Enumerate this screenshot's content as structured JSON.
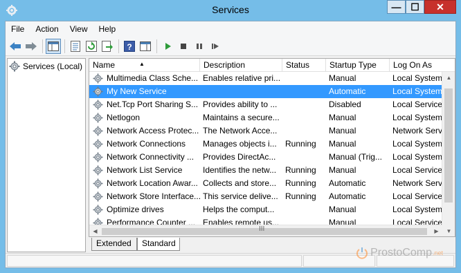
{
  "window": {
    "title": "Services"
  },
  "colors": {
    "selection": "#3399ff",
    "titlebar": "#75bde8",
    "close_button": "#c7312c"
  },
  "window_controls": {
    "minimize": "—",
    "maximize": "☐",
    "close": "✕"
  },
  "menu": [
    "File",
    "Action",
    "View",
    "Help"
  ],
  "toolbar": {
    "icons": [
      "back-arrow-icon",
      "forward-arrow-icon",
      "show-hide-console-tree-icon",
      "properties-icon",
      "refresh-icon",
      "export-list-icon",
      "help-icon",
      "action-pane-icon",
      "start-service-icon",
      "stop-service-icon",
      "pause-service-icon",
      "restart-service-icon"
    ]
  },
  "tree": {
    "root_label": "Services (Local)"
  },
  "table": {
    "columns": [
      "Name",
      "Description",
      "Status",
      "Startup Type",
      "Log On As"
    ],
    "rows": [
      {
        "name": "Multimedia Class Sche...",
        "description": "Enables relative pri...",
        "status": "",
        "startup": "Manual",
        "logon": "Local System",
        "selected": false
      },
      {
        "name": "My New Service",
        "description": "",
        "status": "",
        "startup": "Automatic",
        "logon": "Local System",
        "selected": true
      },
      {
        "name": "Net.Tcp Port Sharing S...",
        "description": "Provides ability to ...",
        "status": "",
        "startup": "Disabled",
        "logon": "Local Service",
        "selected": false
      },
      {
        "name": "Netlogon",
        "description": "Maintains a secure...",
        "status": "",
        "startup": "Manual",
        "logon": "Local System",
        "selected": false
      },
      {
        "name": "Network Access Protec...",
        "description": "The Network Acce...",
        "status": "",
        "startup": "Manual",
        "logon": "Network Servi",
        "selected": false
      },
      {
        "name": "Network Connections",
        "description": "Manages objects i...",
        "status": "Running",
        "startup": "Manual",
        "logon": "Local System",
        "selected": false
      },
      {
        "name": "Network Connectivity ...",
        "description": "Provides DirectAc...",
        "status": "",
        "startup": "Manual (Trig...",
        "logon": "Local System",
        "selected": false
      },
      {
        "name": "Network List Service",
        "description": "Identifies the netw...",
        "status": "Running",
        "startup": "Manual",
        "logon": "Local Service",
        "selected": false
      },
      {
        "name": "Network Location Awar...",
        "description": "Collects and store...",
        "status": "Running",
        "startup": "Automatic",
        "logon": "Network Servi",
        "selected": false
      },
      {
        "name": "Network Store Interface...",
        "description": "This service delive...",
        "status": "Running",
        "startup": "Automatic",
        "logon": "Local Service",
        "selected": false
      },
      {
        "name": "Optimize drives",
        "description": "Helps the comput...",
        "status": "",
        "startup": "Manual",
        "logon": "Local System",
        "selected": false
      },
      {
        "name": "Performance Counter ...",
        "description": "Enables remote us...",
        "status": "",
        "startup": "Manual",
        "logon": "Local Service",
        "selected": false
      }
    ]
  },
  "scrollbar": {
    "grip": "III"
  },
  "tabs": [
    "Extended",
    "Standard"
  ],
  "watermark": {
    "text": "ProstoComp",
    "sub": ".net"
  }
}
